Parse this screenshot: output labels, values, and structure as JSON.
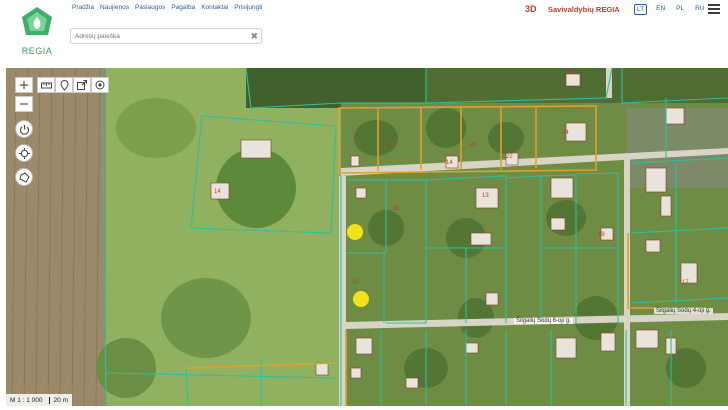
{
  "header": {
    "logo_text": "REGIA",
    "nav": [
      "Pradžia",
      "Naujienos",
      "Paslaugos",
      "Pagalba",
      "Kontaktai",
      "Prisijungti"
    ],
    "search": {
      "placeholder": "Adresų paieška",
      "value": ""
    },
    "btn_3d": "3D",
    "brand": "Savivaldybių REGIA",
    "languages": [
      "LT",
      "EN",
      "PL",
      "RU"
    ],
    "active_language": "LT"
  },
  "map": {
    "scale_text": "M 1 : 1 000",
    "scale_bar": "20 m",
    "road_labels": [
      "Šilgalių Sodų 6-oji g.",
      "Šilgalių Sodų 4-oji g."
    ],
    "parcel_numbers": [
      "3B",
      "16",
      "14",
      "20",
      "22",
      "24",
      "31",
      "13",
      "14",
      "15",
      "17",
      "19"
    ],
    "markers": 2
  },
  "colors": {
    "parcel_line": "#2fbfa0",
    "selected_parcel": "#e0a030",
    "marker": "#f2e21c",
    "brand_red": "#c33b2b",
    "link_blue": "#2b5fa5"
  }
}
